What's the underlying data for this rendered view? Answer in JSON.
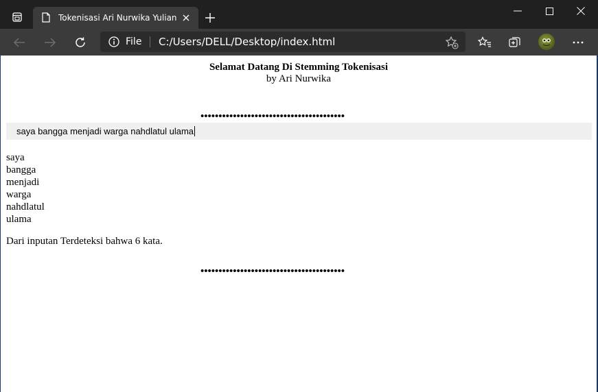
{
  "browser": {
    "tab": {
      "title": "Tokenisasi Ari Nurwika Yulianto"
    },
    "address": {
      "scheme": "File",
      "url": "C:/Users/DELL/Desktop/index.html"
    }
  },
  "page": {
    "title": "Selamat Datang Di Stemming Tokenisasi",
    "subtitle": "by Ari Nurwika",
    "separator": "••••••••••••••••••••••••••••••••••••••••",
    "input": {
      "value": "saya bangga menjadi warga nahdlatul ulama"
    },
    "tokens": [
      "saya",
      "bangga",
      "menjadi",
      "warga",
      "nahdlatul",
      "ulama"
    ],
    "result": "Dari inputan Terdeteksi bahwa 6 kata."
  }
}
